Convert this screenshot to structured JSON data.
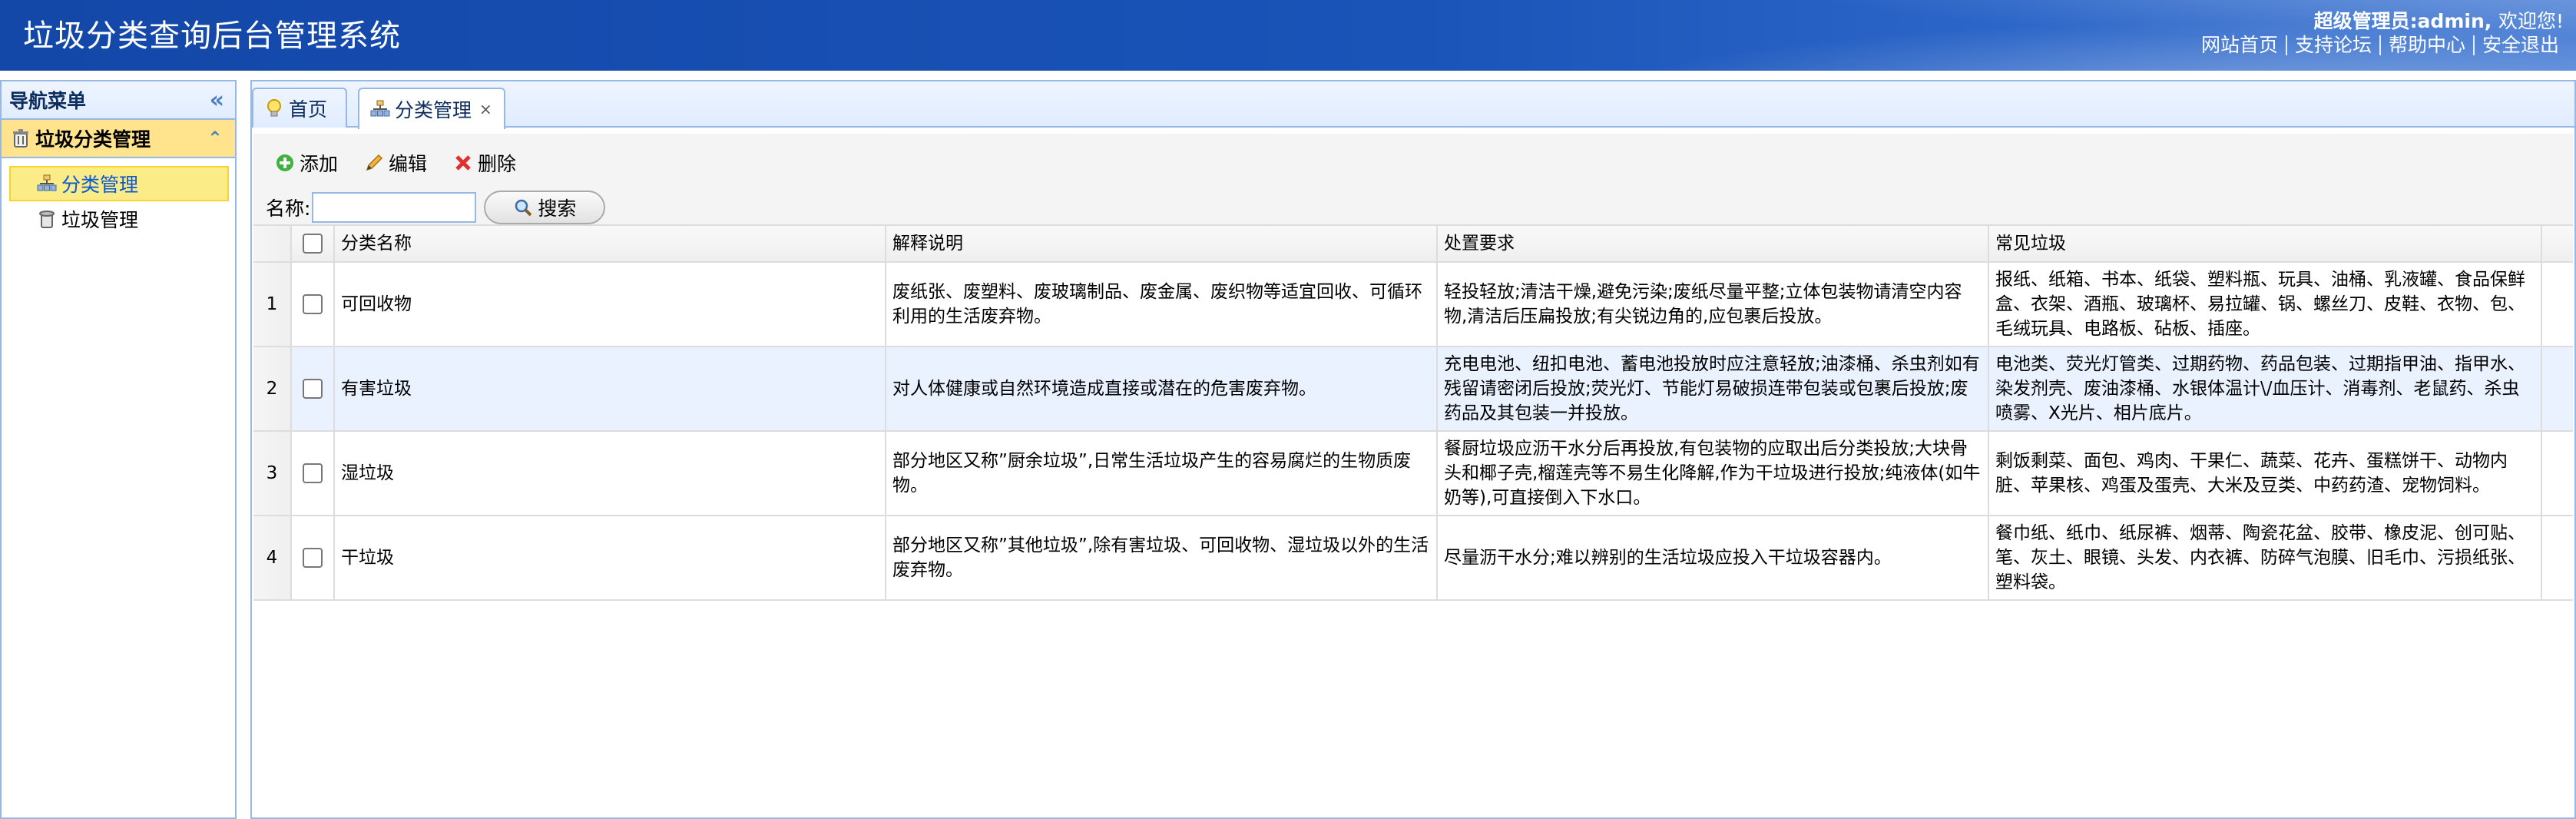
{
  "header": {
    "app_title": "垃圾分类查询后台管理系统",
    "user_role": "超级管理员:admin,",
    "welcome": "欢迎您!",
    "links": [
      "网站首页",
      "支持论坛",
      "帮助中心",
      "安全退出"
    ]
  },
  "sidebar": {
    "title": "导航菜单",
    "collapse_glyph": "«",
    "section": {
      "label": "垃圾分类管理",
      "toggle_glyph": "⌃"
    },
    "items": [
      {
        "label": "分类管理",
        "selected": true
      },
      {
        "label": "垃圾管理",
        "selected": false
      }
    ]
  },
  "tabs": [
    {
      "label": "首页",
      "icon": "bulb-icon"
    },
    {
      "label": "分类管理",
      "icon": "category-icon",
      "closable": true,
      "close_glyph": "×"
    }
  ],
  "toolbar": {
    "add_label": "添加",
    "edit_label": "编辑",
    "delete_label": "删除",
    "name_label": "名称:",
    "name_value": "",
    "search_label": "搜索"
  },
  "table": {
    "columns": [
      "分类名称",
      "解释说明",
      "处置要求",
      "常见垃圾"
    ],
    "rows": [
      {
        "num": "1",
        "name": "可回收物",
        "desc": "废纸张、废塑料、废玻璃制品、废金属、废织物等适宜回收、可循环利用的生活废弃物。",
        "req": "轻投轻放;清洁干燥,避免污染;废纸尽量平整;立体包装物请清空内容物,清洁后压扁投放;有尖锐边角的,应包裹后投放。",
        "common": "报纸、纸箱、书本、纸袋、塑料瓶、玩具、油桶、乳液罐、食品保鲜盒、衣架、酒瓶、玻璃杯、易拉罐、锅、螺丝刀、皮鞋、衣物、包、毛绒玩具、电路板、砧板、插座。"
      },
      {
        "num": "2",
        "name": "有害垃圾",
        "desc": "对人体健康或自然环境造成直接或潜在的危害废弃物。",
        "req": "充电电池、纽扣电池、蓄电池投放时应注意轻放;油漆桶、杀虫剂如有残留请密闭后投放;荧光灯、节能灯易破损连带包装或包裹后投放;废药品及其包装一并投放。",
        "common": "电池类、荧光灯管类、过期药物、药品包装、过期指甲油、指甲水、染发剂壳、废油漆桶、水银体温计\\/血压计、消毒剂、老鼠药、杀虫喷雾、X光片、相片底片。"
      },
      {
        "num": "3",
        "name": "湿垃圾",
        "desc": "部分地区又称”厨余垃圾”,日常生活垃圾产生的容易腐烂的生物质废物。",
        "req": "餐厨垃圾应沥干水分后再投放,有包装物的应取出后分类投放;大块骨头和椰子壳,榴莲壳等不易生化降解,作为干垃圾进行投放;纯液体(如牛奶等),可直接倒入下水口。",
        "common": "剩饭剩菜、面包、鸡肉、干果仁、蔬菜、花卉、蛋糕饼干、动物内脏、苹果核、鸡蛋及蛋壳、大米及豆类、中药药渣、宠物饲料。"
      },
      {
        "num": "4",
        "name": "干垃圾",
        "desc": "部分地区又称”其他垃圾”,除有害垃圾、可回收物、湿垃圾以外的生活废弃物。",
        "req": "尽量沥干水分;难以辨别的生活垃圾应投入干垃圾容器内。",
        "common": "餐巾纸、纸巾、纸尿裤、烟蒂、陶瓷花盆、胶带、橡皮泥、创可贴、笔、灰土、眼镜、头发、内衣裤、防碎气泡膜、旧毛巾、污损纸张、塑料袋。"
      }
    ]
  }
}
